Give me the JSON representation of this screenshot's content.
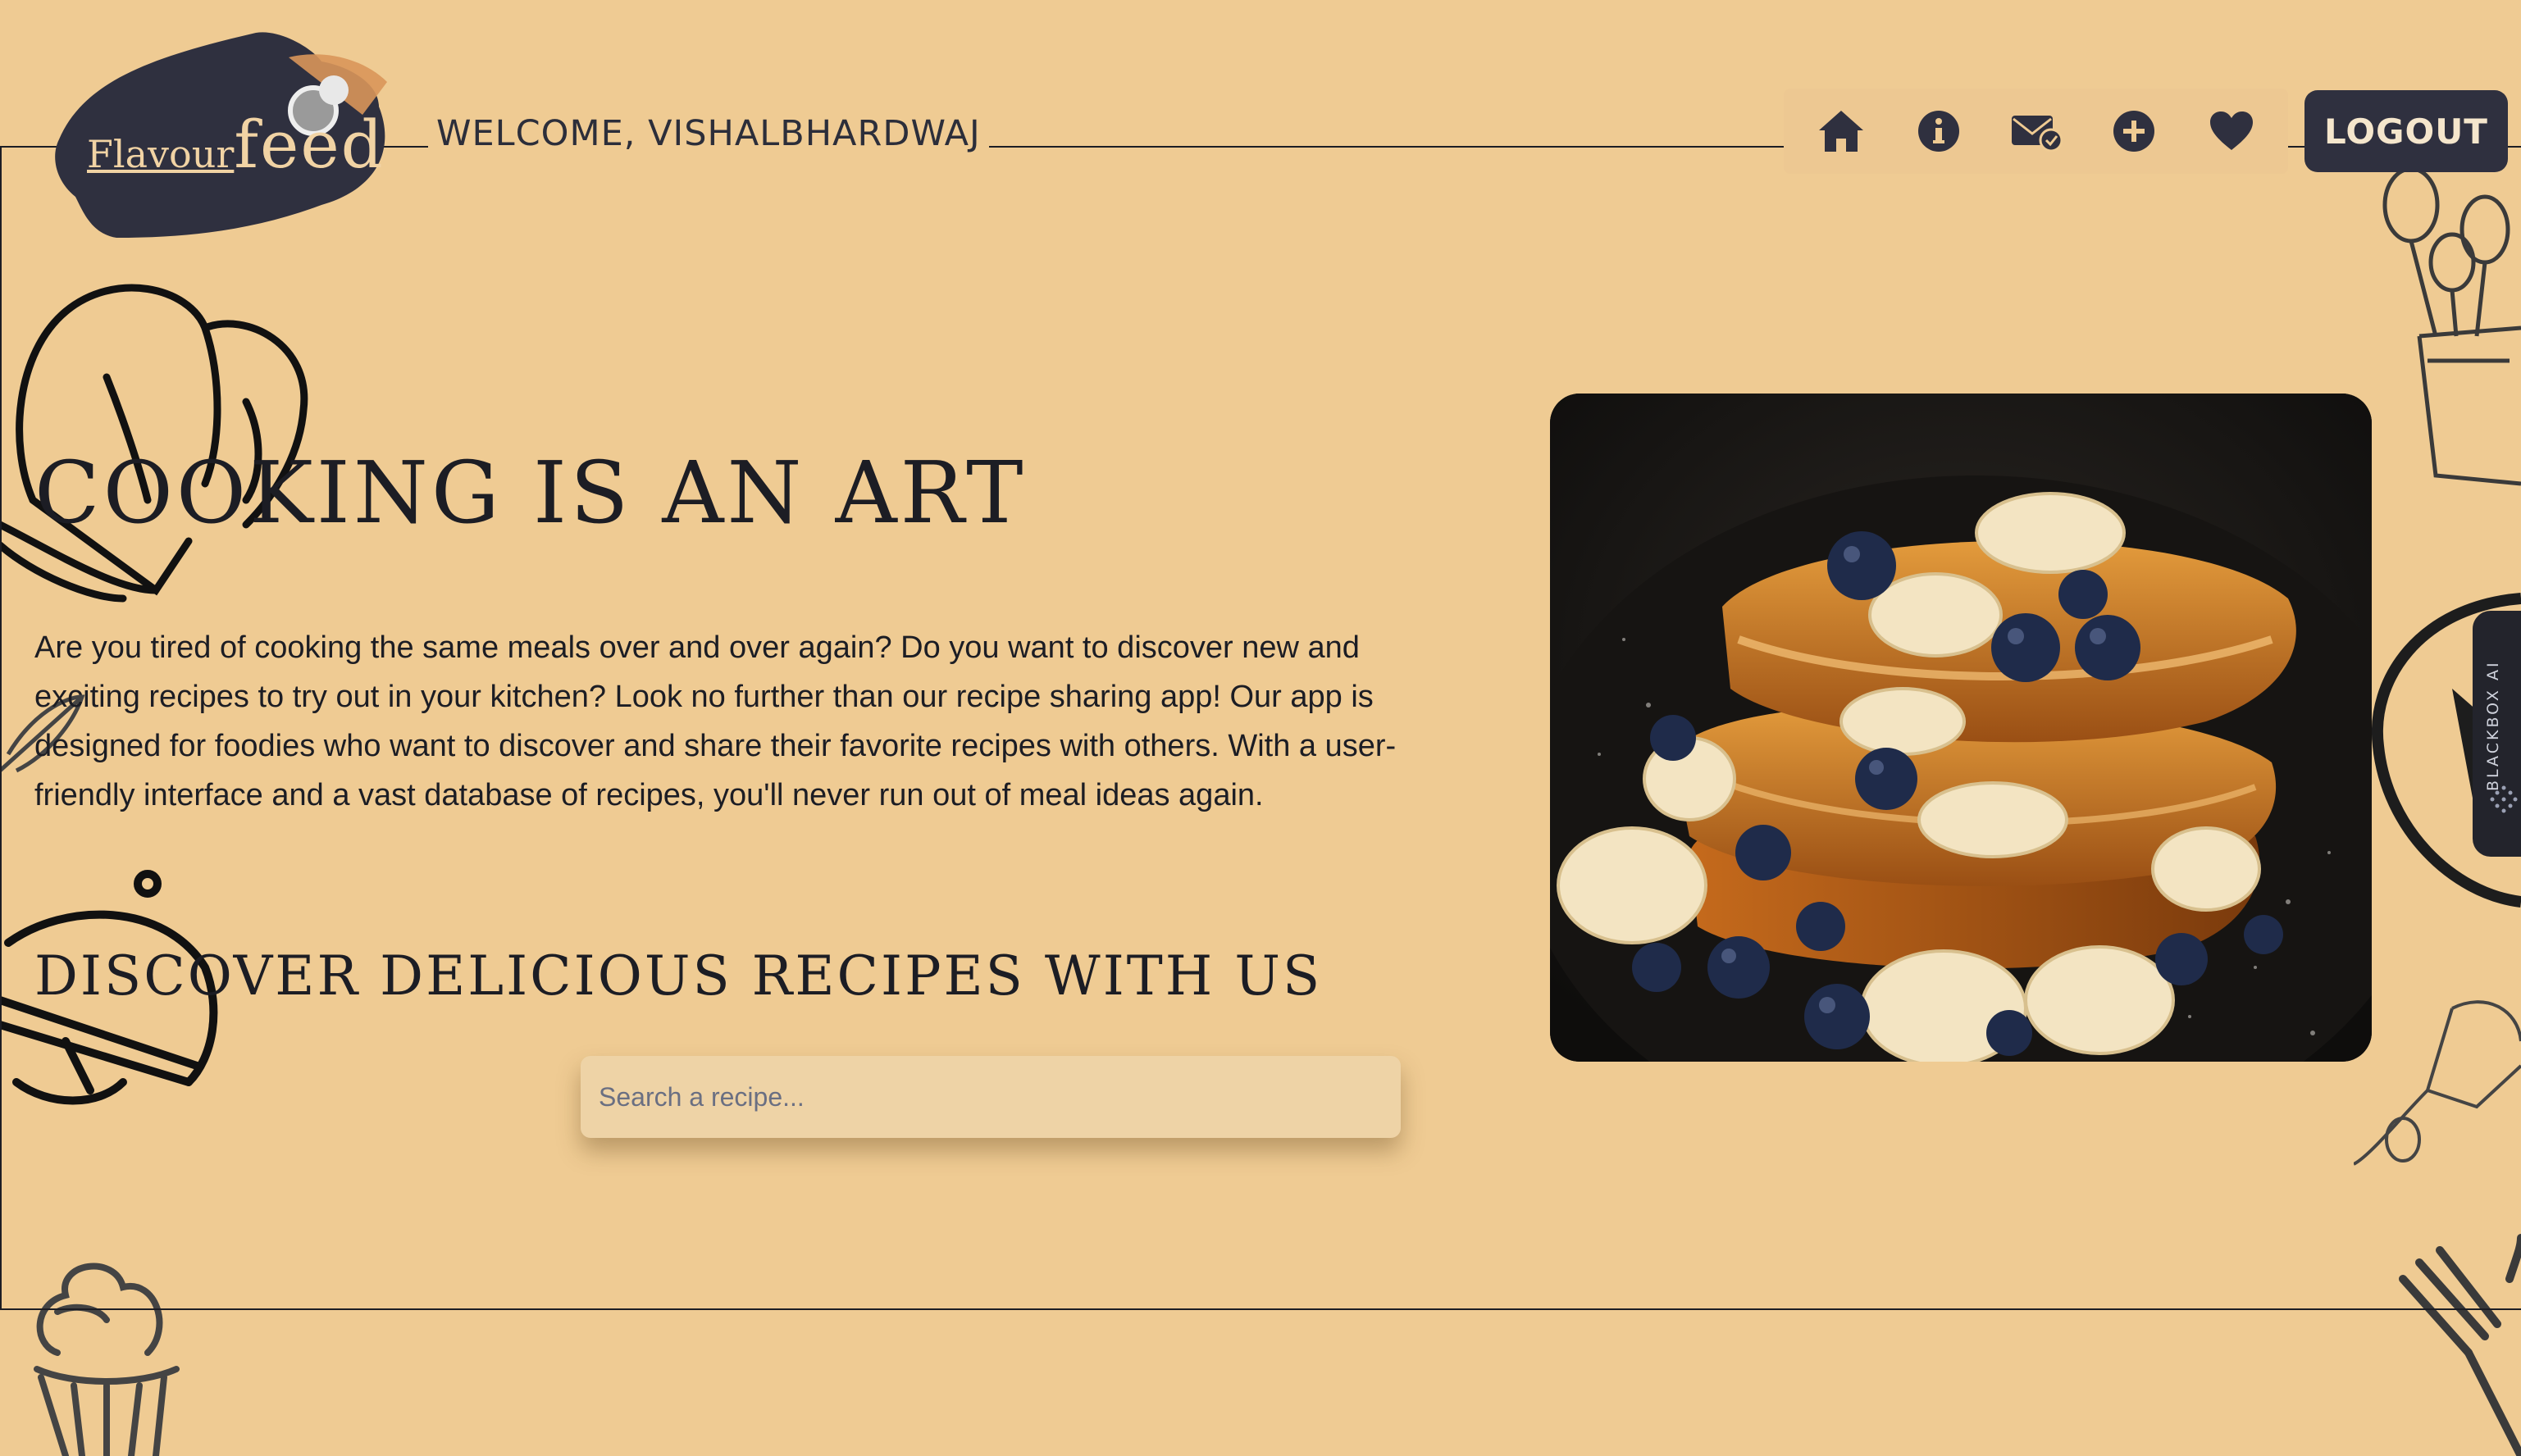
{
  "header": {
    "logo_text_1": "Flavour",
    "logo_text_2": "feed",
    "welcome": "WELCOME, VISHALBHARDWAJ",
    "logout_label": "LOGOUT",
    "nav_icons": [
      "home-icon",
      "info-icon",
      "mail-check-icon",
      "plus-circle-icon",
      "heart-icon"
    ]
  },
  "main": {
    "headline": "COOKING IS AN ART",
    "intro": "Are you tired of cooking the same meals over and over again? Do you want to discover new and exciting recipes to try out in your kitchen? Look no further than our recipe sharing app! Our app is designed for foodies who want to discover and share their favorite recipes with others. With a user-friendly interface and a vast database of recipes, you'll never run out of meal ideas again.",
    "subhead": "DISCOVER DELICIOUS RECIPES WITH US",
    "search_placeholder": "Search a recipe...",
    "search_value": ""
  },
  "side_tab": {
    "label": "BLACKBOX AI"
  },
  "colors": {
    "background": "#efcb93",
    "dark": "#2f303f",
    "text": "#1c1d24"
  }
}
